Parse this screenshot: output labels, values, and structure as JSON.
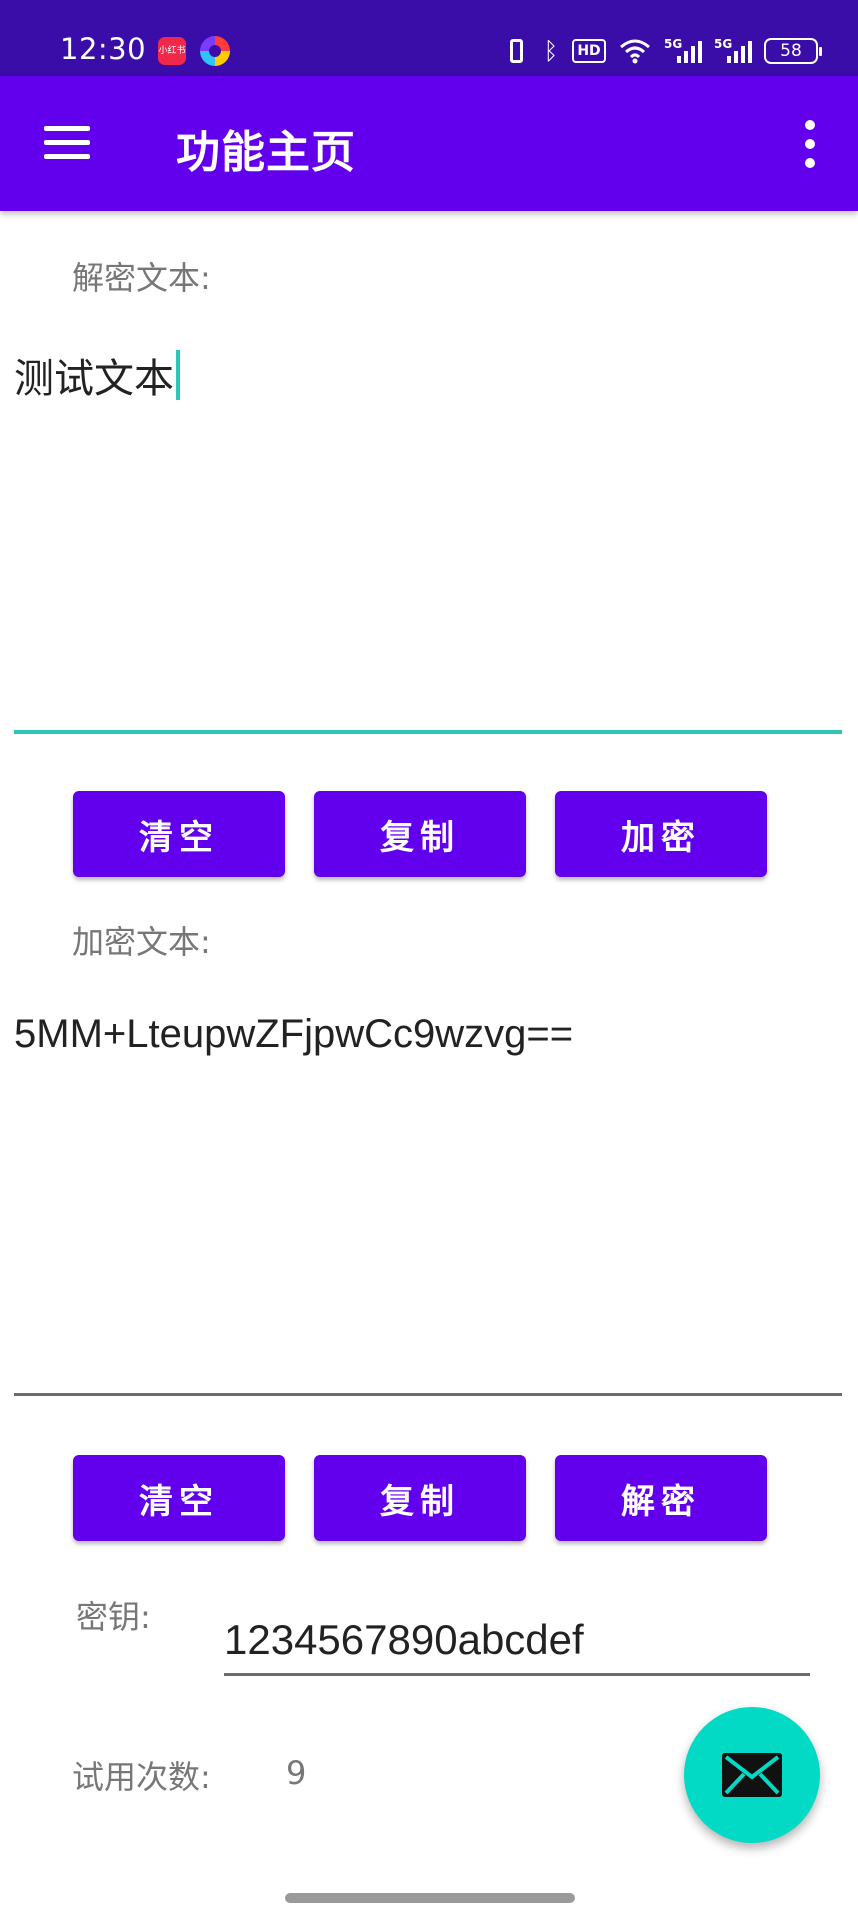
{
  "status_bar": {
    "time": "12:30",
    "app_icon_label": "小红书",
    "hd_label": "HD",
    "net1": "5G",
    "net2": "5G",
    "battery": "58"
  },
  "app_bar": {
    "title": "功能主页"
  },
  "decrypt_section": {
    "label": "解密文本:",
    "value": "测试文本",
    "buttons": {
      "clear": "清空",
      "copy": "复制",
      "action": "加密"
    }
  },
  "encrypt_section": {
    "label": "加密文本:",
    "value": "5MM+LteupwZFjpwCc9wzvg==",
    "buttons": {
      "clear": "清空",
      "copy": "复制",
      "action": "解密"
    }
  },
  "key_section": {
    "label": "密钥:",
    "value": "1234567890abcdef"
  },
  "trial_section": {
    "label": "试用次数:",
    "value": "9"
  },
  "fab": {
    "icon": "mail-icon"
  },
  "colors": {
    "status_bar": "#3a0ca8",
    "primary": "#6200ee",
    "accent": "#03dac5",
    "focus_line": "#2ec4b6"
  }
}
